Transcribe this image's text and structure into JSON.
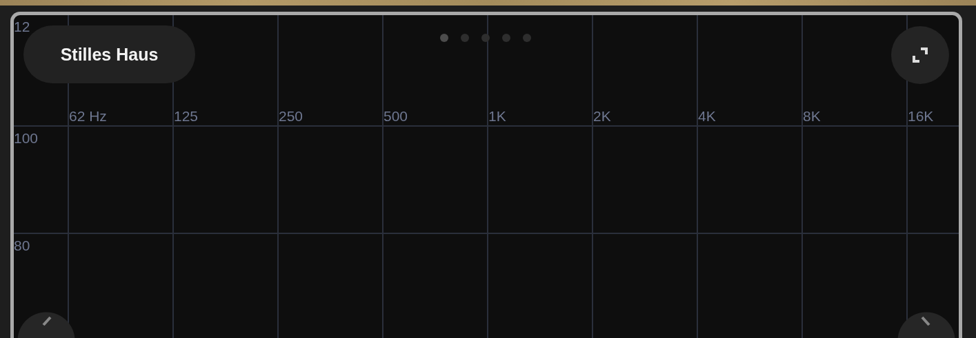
{
  "preset": {
    "title": "Stilles Haus"
  },
  "pages": [
    {
      "selected": true
    },
    {
      "selected": false
    },
    {
      "selected": false
    },
    {
      "selected": false
    },
    {
      "selected": false
    }
  ],
  "chart": {
    "y_labels": [
      "12",
      "100",
      "80"
    ],
    "x_labels": [
      "62 Hz",
      "125",
      "250",
      "500",
      "1K",
      "2K",
      "4K",
      "8K",
      "16K"
    ]
  }
}
